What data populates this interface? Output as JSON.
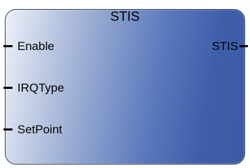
{
  "block": {
    "title": "STIS",
    "inputs": [
      {
        "name": "Enable"
      },
      {
        "name": "IRQType"
      },
      {
        "name": "SetPoint"
      }
    ],
    "outputs": [
      {
        "name": "STIS"
      }
    ]
  }
}
